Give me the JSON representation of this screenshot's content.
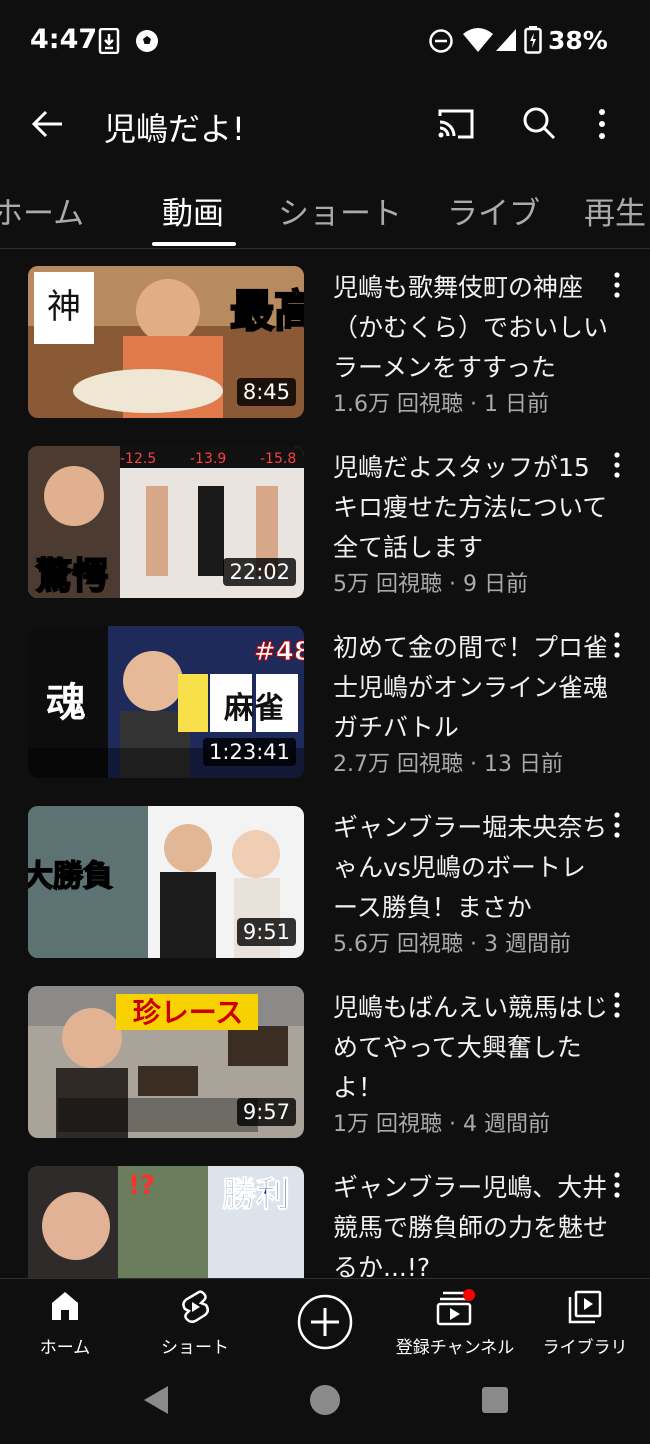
{
  "status_bar": {
    "time": "4:47",
    "battery": "38%"
  },
  "app_bar": {
    "title": "児嶋だよ!",
    "icons": [
      "back-arrow-icon",
      "cast-icon",
      "search-icon",
      "more-vert-icon"
    ]
  },
  "tabs": [
    {
      "label": "ホーム",
      "active": false
    },
    {
      "label": "動画",
      "active": true
    },
    {
      "label": "ショート",
      "active": false
    },
    {
      "label": "ライブ",
      "active": false
    },
    {
      "label": "再生",
      "active": false
    }
  ],
  "videos": [
    {
      "title": "児嶋も歌舞伎町の神座（かむくら）でおいしいラーメンをすすった",
      "meta": "1.6万 回視聴 · 1 日前",
      "duration": "8:45",
      "thumb_text": "最高"
    },
    {
      "title": "児嶋だよスタッフが15キロ痩せた方法について全て話します",
      "meta": "5万 回視聴 · 9 日前",
      "duration": "22:02",
      "thumb_text": "驚愕"
    },
    {
      "title": "初めて金の間で！プロ雀士児嶋がオンライン雀魂ガチバトル",
      "meta": "2.7万 回視聴 · 13 日前",
      "duration": "1:23:41",
      "thumb_text": "麻雀"
    },
    {
      "title": "ギャンブラー堀未央奈ちゃんvs児嶋のボートレース勝負！まさか",
      "meta": "5.6万 回視聴 · 3 週間前",
      "duration": "9:51",
      "thumb_text": "大勝負"
    },
    {
      "title": "児嶋もばんえい競馬はじめてやって大興奮したよ！",
      "meta": "1万 回視聴 · 4 週間前",
      "duration": "9:57",
      "thumb_text": "珍レース"
    },
    {
      "title": "ギャンブラー児嶋、大井競馬で勝負師の力を魅せるか...!?",
      "meta": "",
      "duration": "",
      "thumb_text": "勝利"
    }
  ],
  "bottom_nav": [
    {
      "label": "ホーム"
    },
    {
      "label": "ショート"
    },
    {
      "label": ""
    },
    {
      "label": "登録チャンネル"
    },
    {
      "label": "ライブラリ"
    }
  ],
  "colors": {
    "background": "#0f0f0f",
    "text": "#f1f1f1",
    "secondary": "#aaaaaa",
    "badge": "#ff0000"
  }
}
